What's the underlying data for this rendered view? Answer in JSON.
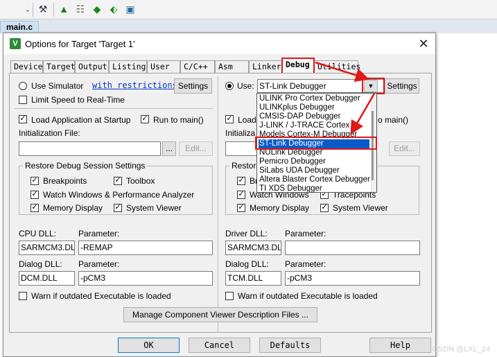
{
  "editor": {
    "file_tab": "main.c"
  },
  "dialog": {
    "title": "Options for Target 'Target 1'",
    "close_icon": "close-icon",
    "tabs": [
      "Device",
      "Target",
      "Output",
      "Listing",
      "User",
      "C/C++",
      "Asm",
      "Linker",
      "Debug",
      "Utilities"
    ],
    "active_tab": "Debug"
  },
  "left": {
    "use_simulator": "Use Simulator",
    "restrictions_link": "with restrictions",
    "settings": "Settings",
    "limit_speed": "Limit Speed to Real-Time",
    "load_app": "Load Application at Startup",
    "run_to_main": "Run to main()",
    "init_file_label": "Initialization File:",
    "browse": "...",
    "edit": "Edit...",
    "restore_title": "Restore Debug Session Settings",
    "breakpoints": "Breakpoints",
    "toolbox": "Toolbox",
    "watch": "Watch Windows & Performance Analyzer",
    "memory": "Memory Display",
    "system_viewer": "System Viewer",
    "cpu_dll_label": "CPU DLL:",
    "param_label": "Parameter:",
    "cpu_dll": "SARMCM3.DLL",
    "cpu_param": "-REMAP",
    "dialog_dll_label": "Dialog DLL:",
    "dialog_dll": "DCM.DLL",
    "dialog_param": "-pCM3",
    "warn": "Warn if outdated Executable is loaded"
  },
  "right": {
    "use": "Use:",
    "selected_debugger": "ST-Link Debugger",
    "settings": "Settings",
    "load_partial": "Load",
    "run_to_main_partial": "o main()",
    "init_partial": "Initializa",
    "browse": "...",
    "edit": "Edit...",
    "restore_partial": "Restore",
    "breakpoints_partial": "Brea",
    "tracepoints": "Tracepoints",
    "watch": "Watch Windows",
    "memory": "Memory Display",
    "system_viewer": "System Viewer",
    "driver_dll_label": "Driver DLL:",
    "param_label": "Parameter:",
    "driver_dll": "SARMCM3.DLL",
    "driver_param": "",
    "dialog_dll_label": "Dialog DLL:",
    "dialog_dll": "TCM.DLL",
    "dialog_param": "-pCM3",
    "warn": "Warn if outdated Executable is loaded"
  },
  "dropdown_options": [
    "ULINK Pro Cortex Debugger",
    "ULINKplus Debugger",
    "CMSIS-DAP Debugger",
    "J-LINK / J-TRACE Cortex",
    "Models Cortex-M Debugger",
    "ST-Link Debugger",
    "NULink Debugger",
    "Pemicro Debugger",
    "SiLabs UDA Debugger",
    "Altera Blaster Cortex Debugger",
    "TI XDS Debugger"
  ],
  "manage_btn": "Manage Component Viewer Description Files ...",
  "footer": {
    "ok": "OK",
    "cancel": "Cancel",
    "defaults": "Defaults",
    "help": "Help"
  },
  "watermark": "CSDN @LXL_24",
  "colors": {
    "annotation_red": "#e01818",
    "selection_blue": "#0b5ac9",
    "link_blue": "#0033cc"
  }
}
